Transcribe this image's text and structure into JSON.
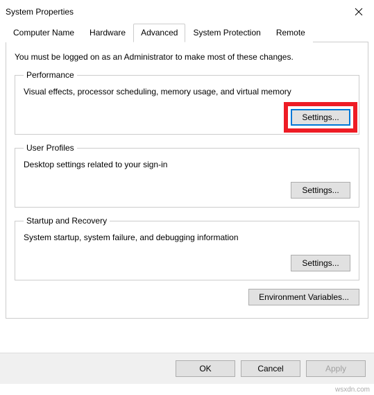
{
  "window": {
    "title": "System Properties"
  },
  "tabs": {
    "computer_name": "Computer Name",
    "hardware": "Hardware",
    "advanced": "Advanced",
    "system_protection": "System Protection",
    "remote": "Remote"
  },
  "advanced": {
    "intro": "You must be logged on as an Administrator to make most of these changes.",
    "performance": {
      "legend": "Performance",
      "desc": "Visual effects, processor scheduling, memory usage, and virtual memory",
      "settings_btn": "Settings..."
    },
    "user_profiles": {
      "legend": "User Profiles",
      "desc": "Desktop settings related to your sign-in",
      "settings_btn": "Settings..."
    },
    "startup_recovery": {
      "legend": "Startup and Recovery",
      "desc": "System startup, system failure, and debugging information",
      "settings_btn": "Settings..."
    },
    "env_vars_btn": "Environment Variables..."
  },
  "buttons": {
    "ok": "OK",
    "cancel": "Cancel",
    "apply": "Apply"
  },
  "watermark": "wsxdn.com"
}
